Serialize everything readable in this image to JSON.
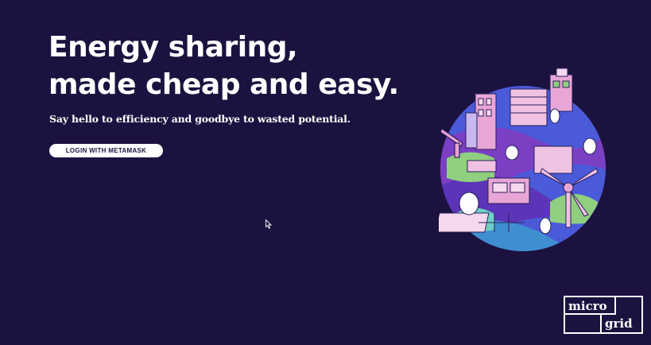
{
  "hero": {
    "headline_line1": "Energy sharing,",
    "headline_line2": "made cheap and easy.",
    "subtitle": "Say hello to efficiency and goodbye to wasted potential.",
    "login_button": "LOGIN WITH METAMASK"
  },
  "logo": {
    "word1": "micro",
    "word2": "grid"
  },
  "colors": {
    "background": "#1c123f",
    "text": "#ffffff",
    "button_bg": "#ffffff",
    "button_text": "#1c123f",
    "globe_blue": "#4a5ad8",
    "globe_purple": "#7b3fc4",
    "globe_pink": "#e8a6d6",
    "globe_green": "#8fcf7f"
  },
  "icons": {
    "cursor": "mouse-pointer-icon",
    "illustration": "city-globe-illustration"
  }
}
